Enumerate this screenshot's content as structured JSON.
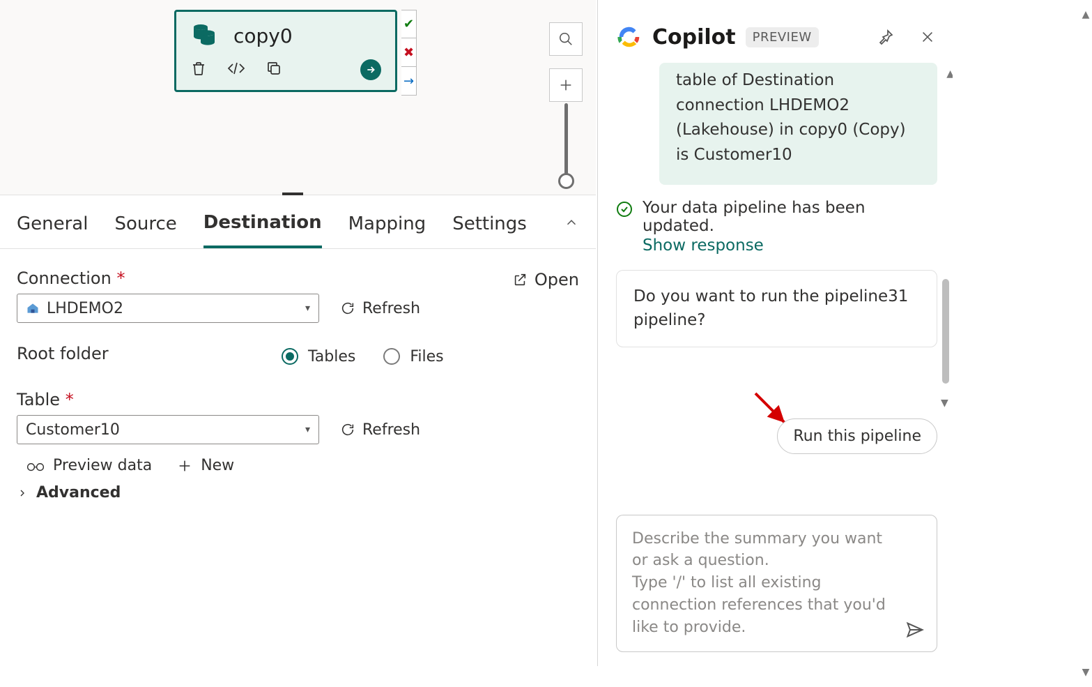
{
  "canvas": {
    "activity": {
      "title": "copy0"
    },
    "ports": {
      "success": "✔",
      "fail": "✖",
      "skip": "→"
    }
  },
  "tabs": {
    "items": [
      "General",
      "Source",
      "Destination",
      "Mapping",
      "Settings"
    ],
    "active_index": 2
  },
  "destination": {
    "connection_label": "Connection",
    "connection_value": "LHDEMO2",
    "open_label": "Open",
    "refresh_label": "Refresh",
    "root_folder_label": "Root folder",
    "root_options": {
      "tables": "Tables",
      "files": "Files"
    },
    "root_selected": "tables",
    "table_label": "Table",
    "table_value": "Customer10",
    "preview_label": "Preview data",
    "new_label": "New",
    "advanced_label": "Advanced"
  },
  "copilot": {
    "title": "Copilot",
    "badge": "PREVIEW",
    "green_msg": "table of Destination connection LHDEMO2 (Lakehouse) in copy0 (Copy) is Customer10",
    "status_text": "Your data pipeline has been updated.",
    "show_response": "Show response",
    "prompt_card": "Do you want to run the pipeline31 pipeline?",
    "run_btn": "Run this pipeline",
    "placeholder": "Describe the summary you want or ask a question.\nType '/' to list all existing connection references that you'd like to provide."
  }
}
